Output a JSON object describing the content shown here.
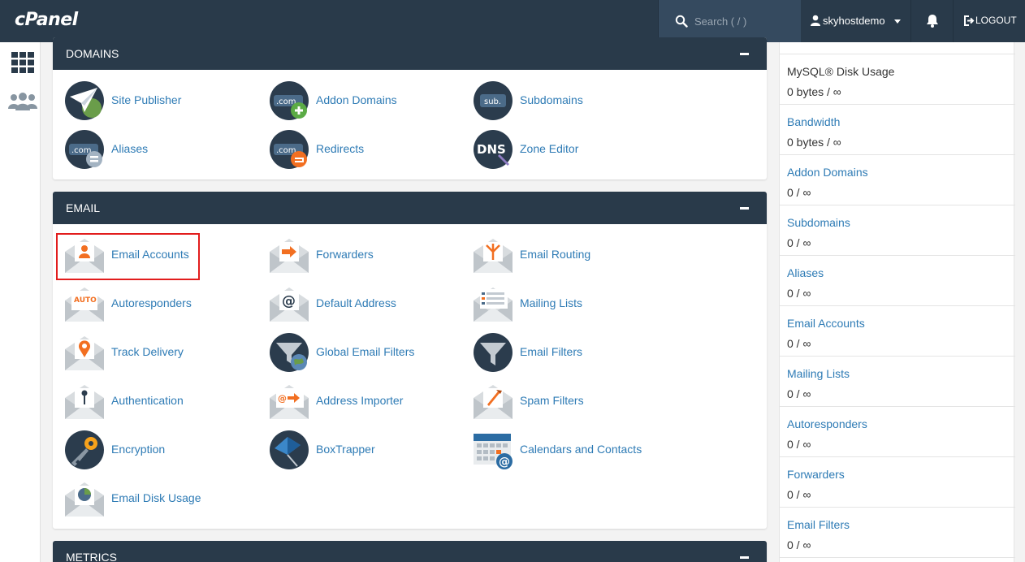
{
  "header": {
    "logo": "cPanel",
    "search_placeholder": "Search ( / )",
    "username": "skyhostdemo",
    "logout_label": "LOGOUT"
  },
  "sections": {
    "domains": {
      "title": "DOMAINS",
      "items": [
        "Site Publisher",
        "Addon Domains",
        "Subdomains",
        "Aliases",
        "Redirects",
        "Zone Editor"
      ]
    },
    "email": {
      "title": "EMAIL",
      "items": [
        "Email Accounts",
        "Forwarders",
        "Email Routing",
        "Autoresponders",
        "Default Address",
        "Mailing Lists",
        "Track Delivery",
        "Global Email Filters",
        "Email Filters",
        "Authentication",
        "Address Importer",
        "Spam Filters",
        "Encryption",
        "BoxTrapper",
        "Calendars and Contacts",
        "Email Disk Usage"
      ]
    },
    "metrics": {
      "title": "METRICS"
    }
  },
  "stats": [
    {
      "label": "MySQL® Disk Usage",
      "value": "0 bytes / ∞"
    },
    {
      "label": "Bandwidth",
      "value": "0 bytes / ∞"
    },
    {
      "label": "Addon Domains",
      "value": "0 / ∞"
    },
    {
      "label": "Subdomains",
      "value": "0 / ∞"
    },
    {
      "label": "Aliases",
      "value": "0 / ∞"
    },
    {
      "label": "Email Accounts",
      "value": "0 / ∞"
    },
    {
      "label": "Mailing Lists",
      "value": "0 / ∞"
    },
    {
      "label": "Autoresponders",
      "value": "0 / ∞"
    },
    {
      "label": "Forwarders",
      "value": "0 / ∞"
    },
    {
      "label": "Email Filters",
      "value": "0 / ∞"
    }
  ],
  "colors": {
    "topbar": "#293a4a",
    "link": "#2e7bb5",
    "accent_orange": "#f26f21",
    "highlight_red": "#e21d1d"
  }
}
